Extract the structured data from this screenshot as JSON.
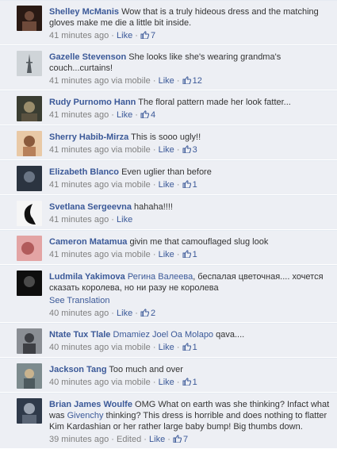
{
  "comments": [
    {
      "author": "Shelley McManis",
      "text": "Wow that is a truly hideous dress and the matching gloves make me die a little bit inside.",
      "time": "41 minutes ago",
      "via": "",
      "like_label": "Like",
      "likes": "7",
      "avatar_colors": [
        "#2a1a14",
        "#6e4a3a"
      ]
    },
    {
      "author": "Gazelle Stevenson",
      "text": "She looks like she's wearing grandma's couch...curtains!",
      "time": "41 minutes ago",
      "via": "via mobile",
      "like_label": "Like",
      "likes": "12",
      "avatar_colors": [
        "#cfd4d8",
        "#555b60"
      ]
    },
    {
      "author": "Rudy Purnomo Hann",
      "text": "The floral pattern made her look fatter...",
      "time": "41 minutes ago",
      "via": "",
      "like_label": "Like",
      "likes": "4",
      "avatar_colors": [
        "#3a3d32",
        "#9a8d6c"
      ]
    },
    {
      "author": "Sherry Habib-Mirza",
      "text": "This is sooo ugly!!",
      "time": "41 minutes ago",
      "via": "via mobile",
      "like_label": "Like",
      "likes": "3",
      "avatar_colors": [
        "#e9c9a6",
        "#8a5a3c"
      ]
    },
    {
      "author": "Elizabeth Blanco",
      "text": "Even uglier than before",
      "time": "41 minutes ago",
      "via": "via mobile",
      "like_label": "Like",
      "likes": "1",
      "avatar_colors": [
        "#2b3440",
        "#6a7584"
      ]
    },
    {
      "author": "Svetlana Sergeevna",
      "text": "hahaha!!!!",
      "time": "41 minutes ago",
      "via": "",
      "like_label": "Like",
      "likes": "",
      "avatar_colors": [
        "#f6f6f6",
        "#111111"
      ]
    },
    {
      "author": "Cameron Matamua",
      "text": "givin me that camouflaged slug look",
      "time": "41 minutes ago",
      "via": "via mobile",
      "like_label": "Like",
      "likes": "1",
      "avatar_colors": [
        "#e3a4a4",
        "#b15b5b"
      ]
    },
    {
      "author": "Ludmila Yakimova",
      "text_link": "Регина Валеева",
      "text": ", беспалая цветочная.... хочется сказать королева, но ни разу не королева",
      "see_translation": "See Translation",
      "time": "40 minutes ago",
      "via": "",
      "like_label": "Like",
      "likes": "2",
      "avatar_colors": [
        "#0e0e0e",
        "#4a4a4a"
      ]
    },
    {
      "author": "Ntate Tux Tlale",
      "text_link": "Dmamiez Joel Oa Molapo",
      "text": " qava....",
      "time": "40 minutes ago",
      "via": "via mobile",
      "like_label": "Like",
      "likes": "1",
      "avatar_colors": [
        "#8a8e94",
        "#3d3f44"
      ]
    },
    {
      "author": "Jackson Tang",
      "text": "Too much and over",
      "time": "40 minutes ago",
      "via": "via mobile",
      "like_label": "Like",
      "likes": "1",
      "avatar_colors": [
        "#7d8b8e",
        "#c9b38e"
      ]
    },
    {
      "author": "Brian James Woulfe",
      "text_before": "OMG What on earth was she thinking? Infact what was ",
      "text_link": "Givenchy",
      "text": " thinking? This dress is horrible and does nothing to flatter Kim Kardashian or her rather large baby bump! Big thumbs down.",
      "time": "39 minutes ago",
      "via": "",
      "edited": "Edited",
      "like_label": "Like",
      "likes": "7",
      "avatar_colors": [
        "#2f3a4a",
        "#9aa3b0"
      ]
    }
  ],
  "colors": {
    "link": "#3b5998",
    "meta": "#808080",
    "text": "#333333",
    "row_bg": "#edeff4"
  },
  "icons": {
    "thumb": "thumbs-up-icon"
  }
}
